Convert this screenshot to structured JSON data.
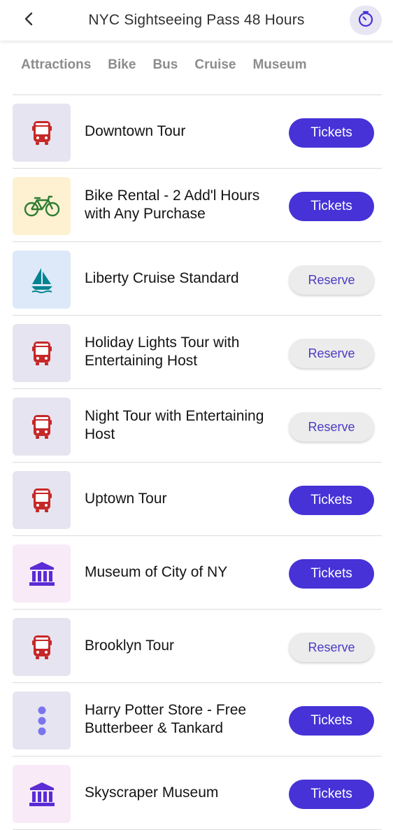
{
  "header": {
    "title": "NYC Sightseeing Pass 48 Hours",
    "back_icon": "chevron-left-icon",
    "timer_icon": "timer-icon"
  },
  "tabs": [
    {
      "label": "Attractions"
    },
    {
      "label": "Bike"
    },
    {
      "label": "Bus"
    },
    {
      "label": "Cruise"
    },
    {
      "label": "Museum"
    }
  ],
  "colors": {
    "accent": "#4632d6",
    "bus_red": "#c62828",
    "bike_green": "#2e7d32",
    "cruise_teal": "#00838f",
    "museum_purple": "#5b2bd6",
    "bus_bg": "#e6e4f0",
    "bike_bg": "#fdf1d2",
    "cruise_bg": "#dde9f8",
    "museum_bg": "#f8eaf6"
  },
  "items": [
    {
      "title": "Downtown Tour",
      "icon": "bus-icon",
      "button": "Tickets"
    },
    {
      "title": "Bike Rental - 2 Add'l Hours with Any Purchase",
      "icon": "bike-icon",
      "button": "Tickets"
    },
    {
      "title": "Liberty Cruise Standard",
      "icon": "sailboat-icon",
      "button": "Reserve"
    },
    {
      "title": "Holiday Lights Tour with Entertaining Host",
      "icon": "bus-icon",
      "button": "Reserve"
    },
    {
      "title": "Night Tour with Entertaining Host",
      "icon": "bus-icon",
      "button": "Reserve"
    },
    {
      "title": "Uptown Tour",
      "icon": "bus-icon",
      "button": "Tickets"
    },
    {
      "title": "Museum of City of NY",
      "icon": "museum-icon",
      "button": "Tickets"
    },
    {
      "title": "Brooklyn Tour",
      "icon": "bus-icon",
      "button": "Reserve"
    },
    {
      "title": "Harry Potter Store - Free Butterbeer & Tankard",
      "icon": "more-dots-icon",
      "button": "Tickets"
    },
    {
      "title": "Skyscraper Museum",
      "icon": "museum-icon",
      "button": "Tickets"
    }
  ]
}
